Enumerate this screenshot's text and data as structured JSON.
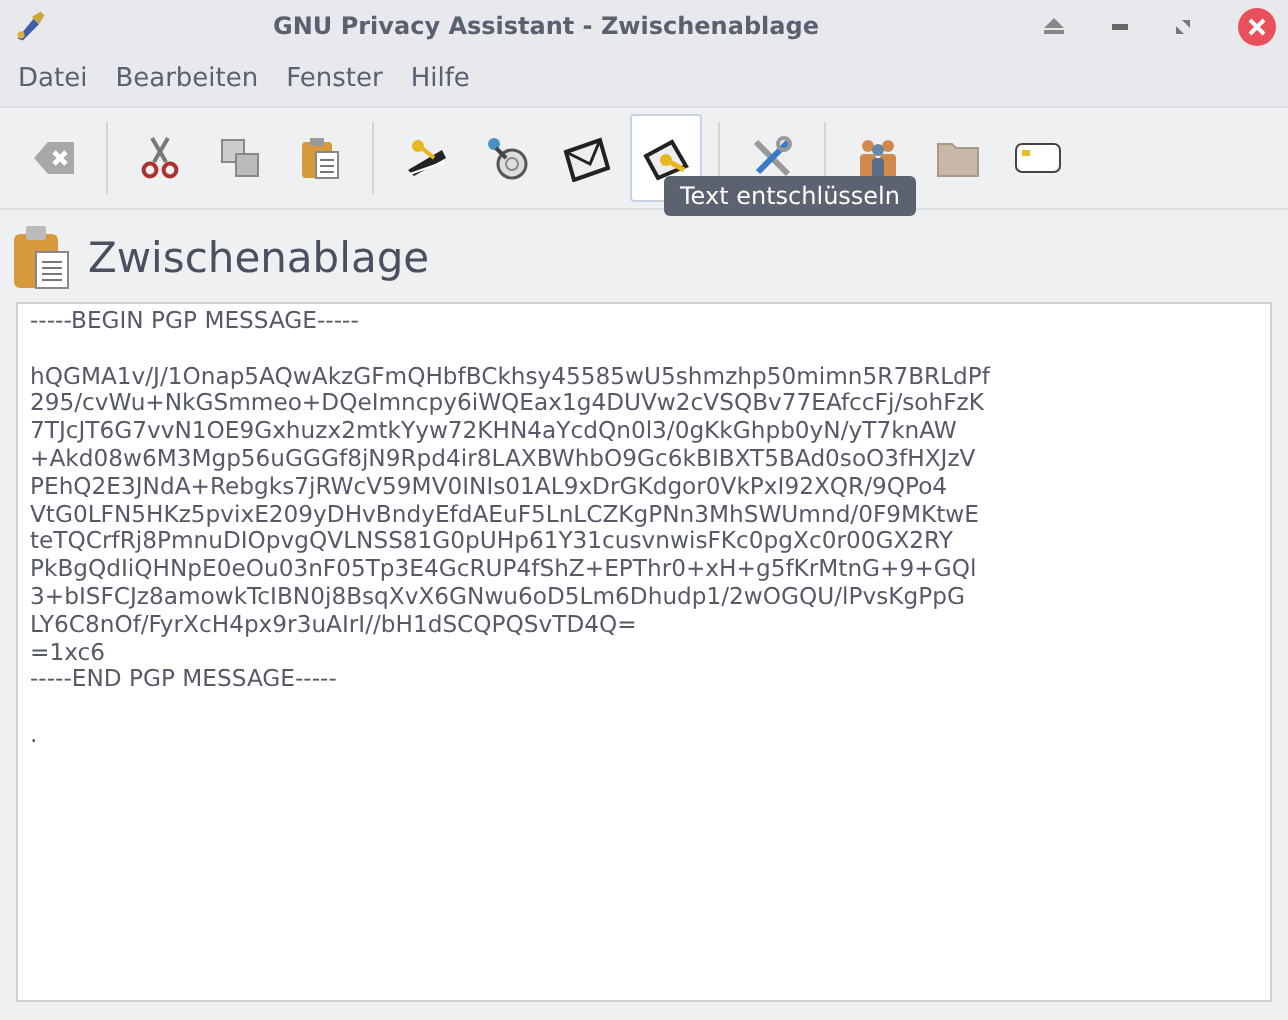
{
  "window": {
    "title": "GNU Privacy Assistant - Zwischenablage"
  },
  "menu": [
    "Datei",
    "Bearbeiten",
    "Fenster",
    "Hilfe"
  ],
  "toolbar": {
    "groups": [
      [
        {
          "kind": "clear",
          "hovered": false
        }
      ],
      [
        {
          "kind": "cut",
          "hovered": false
        },
        {
          "kind": "copy",
          "hovered": false
        },
        {
          "kind": "paste",
          "hovered": false
        }
      ],
      [
        {
          "kind": "sign",
          "hovered": false
        },
        {
          "kind": "verify",
          "hovered": false
        },
        {
          "kind": "encrypt",
          "hovered": false
        },
        {
          "kind": "decrypt",
          "hovered": true
        }
      ],
      [
        {
          "kind": "settings",
          "hovered": false
        }
      ],
      [
        {
          "kind": "keyring",
          "hovered": false
        },
        {
          "kind": "files",
          "hovered": false
        },
        {
          "kind": "card",
          "hovered": false
        }
      ]
    ]
  },
  "tooltip": {
    "text": "Text entschlüsseln"
  },
  "header": {
    "title": "Zwischenablage"
  },
  "editor": {
    "paragraphs": [
      [
        "-----BEGIN PGP MESSAGE-----"
      ],
      [
        "hQGMA1v/J/1Onap5AQwAkzGFmQHbfBCkhsy45585wU5shmzhp50mimn5R7BRLdPf",
        "295/cvWu+NkGSmmeo+DQeImncpy6iWQEax1g4DUVw2cVSQBv77EAfccFj/sohFzK",
        "7TJcJT6G7vvN1OE9Gxhuzx2mtkYyw72KHN4aYcdQn0l3/0gKkGhpb0yN/yT7knAW",
        "+Akd08w6M3Mgp56uGGGf8jN9Rpd4ir8LAXBWhbO9Gc6kBIBXT5BAd0soO3fHXJzV",
        "PEhQ2E3JNdA+Rebgks7jRWcV59MV0INIs01AL9xDrGKdgor0VkPxI92XQR/9QPo4",
        "VtG0LFN5HKz5pvixE209yDHvBndyEfdAEuF5LnLCZKgPNn3MhSWUmnd/0F9MKtwE",
        "teTQCrfRj8PmnuDIOpvgQVLNSS81G0pUHp61Y31cusvnwisFKc0pgXc0r00GX2RY",
        "PkBgQdIiQHNpE0eOu03nF05Tp3E4GcRUP4fShZ+EPThr0+xH+g5fKrMtnG+9+GQl",
        "3+bISFCJz8amowkTcIBN0j8BsqXvX6GNwu6oD5Lm6Dhudp1/2wOGQU/lPvsKgPpG",
        "LY6C8nOf/FyrXcH4px9r3uAIrI//bH1dSCQPQSvTD4Q=",
        "=1xc6",
        "-----END PGP MESSAGE-----"
      ],
      [
        "."
      ]
    ]
  }
}
